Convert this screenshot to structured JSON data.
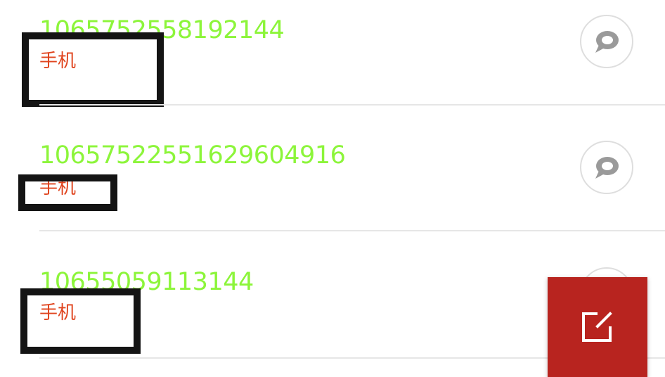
{
  "contacts": [
    {
      "number": "1065752558192144",
      "type": "手机"
    },
    {
      "number": "10657522551629604916",
      "type": "手机"
    },
    {
      "number": "10655059113144",
      "type": "手机"
    }
  ],
  "icons": {
    "message": "chat-bubble-icon",
    "compose": "compose-icon"
  },
  "colors": {
    "number": "#8cf53a",
    "type": "#e0451f",
    "fab": "#b8241f",
    "redaction": "#141414"
  }
}
